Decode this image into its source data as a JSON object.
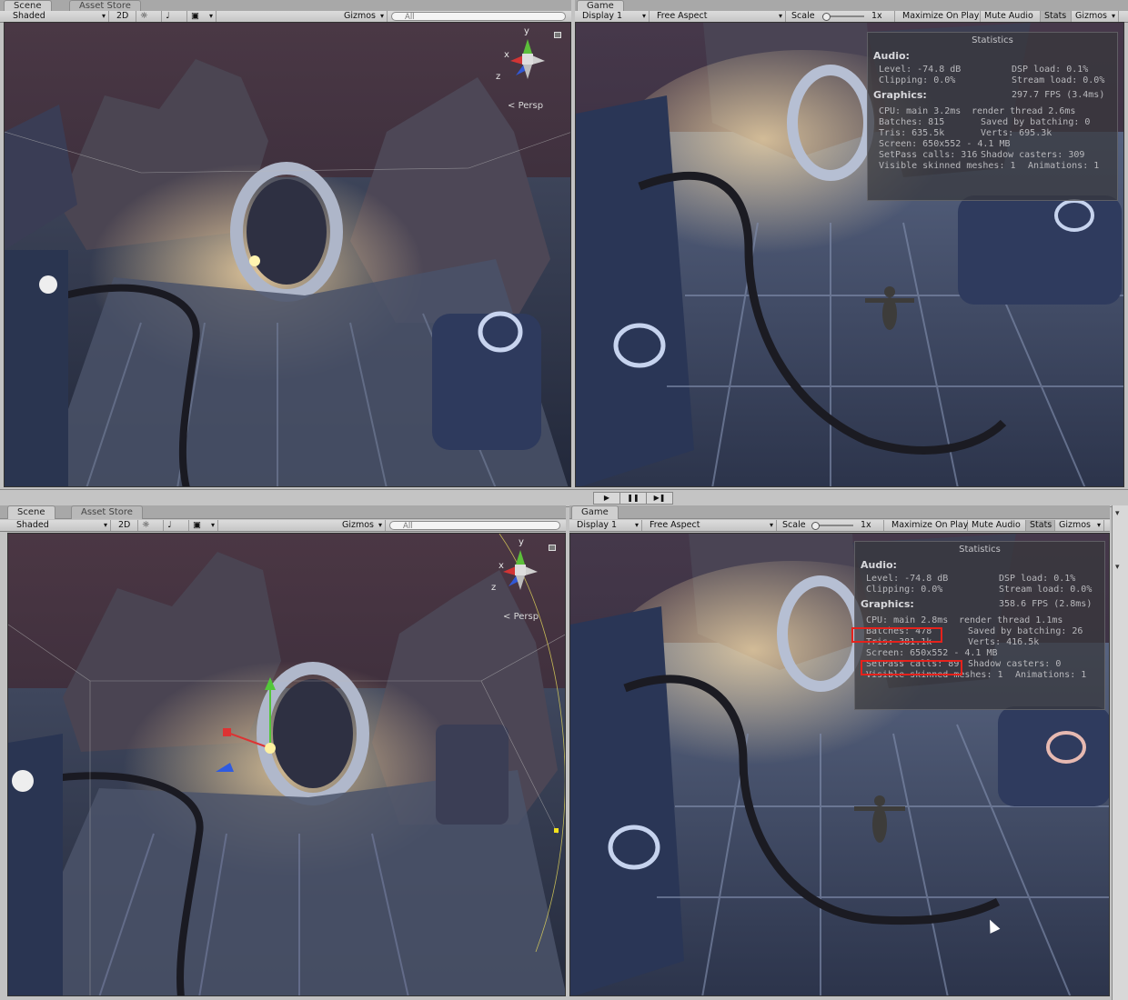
{
  "colors": {
    "highlight": "#e6221c",
    "stats_bg": "#37373c"
  },
  "top": {
    "scene": {
      "tabs": [
        "Scene",
        "Asset Store"
      ],
      "shading": "Shaded",
      "mode_2d": "2D",
      "gizmos": "Gizmos",
      "search_placeholder": "All",
      "axis_labels": {
        "x": "x",
        "y": "y",
        "z": "z"
      },
      "persp": "Persp"
    },
    "game": {
      "tab": "Game",
      "display": "Display 1",
      "aspect": "Free Aspect",
      "scale_label": "Scale",
      "scale_value": "1x",
      "maximize": "Maximize On Play",
      "mute": "Mute Audio",
      "stats": "Stats",
      "gizmos": "Gizmos",
      "statistics": {
        "title": "Statistics",
        "audio_header": "Audio:",
        "level": "Level: -74.8 dB",
        "dsp": "DSP load: 0.1%",
        "clipping": "Clipping: 0.0%",
        "stream": "Stream load: 0.0%",
        "graphics_header": "Graphics:",
        "fps": "297.7 FPS (3.4ms)",
        "cpu": "CPU: main 3.2ms",
        "render_thread": "render thread 2.6ms",
        "batches": "Batches: 815",
        "saved_batching": "Saved by batching: 0",
        "tris": "Tris: 635.5k",
        "verts": "Verts: 695.3k",
        "screen": "Screen: 650x552 - 4.1 MB",
        "setpass": "SetPass calls: 316",
        "shadow_casters": "Shadow casters: 309",
        "skinned": "Visible skinned meshes: 1",
        "animations": "Animations: 1"
      }
    }
  },
  "bottom": {
    "scene": {
      "tabs": [
        "Scene",
        "Asset Store"
      ],
      "shading": "Shaded",
      "mode_2d": "2D",
      "gizmos": "Gizmos",
      "search_placeholder": "All",
      "axis_labels": {
        "x": "x",
        "y": "y",
        "z": "z"
      },
      "persp": "Persp"
    },
    "game": {
      "tab": "Game",
      "display": "Display 1",
      "aspect": "Free Aspect",
      "scale_label": "Scale",
      "scale_value": "1x",
      "maximize": "Maximize On Play",
      "mute": "Mute Audio",
      "stats": "Stats",
      "gizmos": "Gizmos",
      "statistics": {
        "title": "Statistics",
        "audio_header": "Audio:",
        "level": "Level: -74.8 dB",
        "dsp": "DSP load: 0.1%",
        "clipping": "Clipping: 0.0%",
        "stream": "Stream load: 0.0%",
        "graphics_header": "Graphics:",
        "fps": "358.6 FPS (2.8ms)",
        "cpu": "CPU: main 2.8ms",
        "render_thread": "render thread 1.1ms",
        "batches": "Batches: 478",
        "saved_batching": "Saved by batching: 26",
        "tris": "Tris: 381.1k",
        "verts": "Verts: 416.5k",
        "screen": "Screen: 650x552 - 4.1 MB",
        "setpass": "SetPass calls: 89",
        "shadow_casters": "Shadow casters: 0",
        "skinned": "Visible skinned meshes: 1",
        "animations": "Animations: 1"
      }
    }
  }
}
